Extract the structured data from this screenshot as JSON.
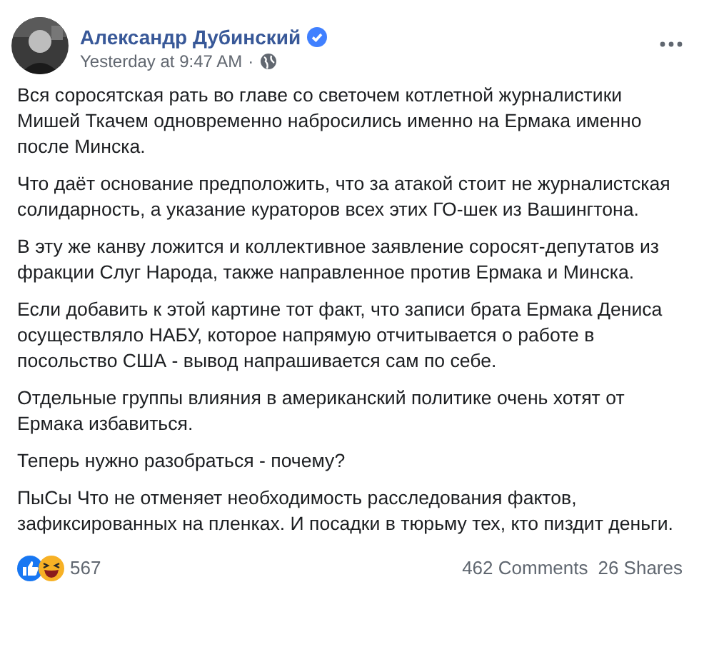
{
  "post": {
    "author": "Александр Дубинский",
    "verified": true,
    "time": "Yesterday at 9:47 AM",
    "separator": "·",
    "paragraphs": [
      "Вся соросятская рать во главе со светочем котлетной журналистики Мишей Ткачем одновременно набросились именно на Ермака именно после Минска.",
      "Что даёт основание предположить, что за атакой стоит не журналистская солидарность, а указание кураторов всех этих ГО-шек из Вашингтона.",
      "В эту же канву ложится и коллективное заявление соросят-депутатов из фракции Слуг Народа, также направленное против Ермака и Минска.",
      "Если добавить к этой картине тот факт, что записи брата Ермака Дениса осуществляло НАБУ, которое напрямую отчитывается о работе в посольство США - вывод напрашивается сам по себе.",
      "Отдельные группы влияния в американский политике очень хотят от Ермака избавиться.",
      "Теперь нужно разобраться - почему?",
      "ПыСы Что не отменяет необходимость расследования фактов, зафиксированных на пленках. И посадки в тюрьму тех, кто пиздит деньги."
    ]
  },
  "footer": {
    "reactions_count": "567",
    "comments": "462 Comments",
    "shares": "26 Shares"
  }
}
